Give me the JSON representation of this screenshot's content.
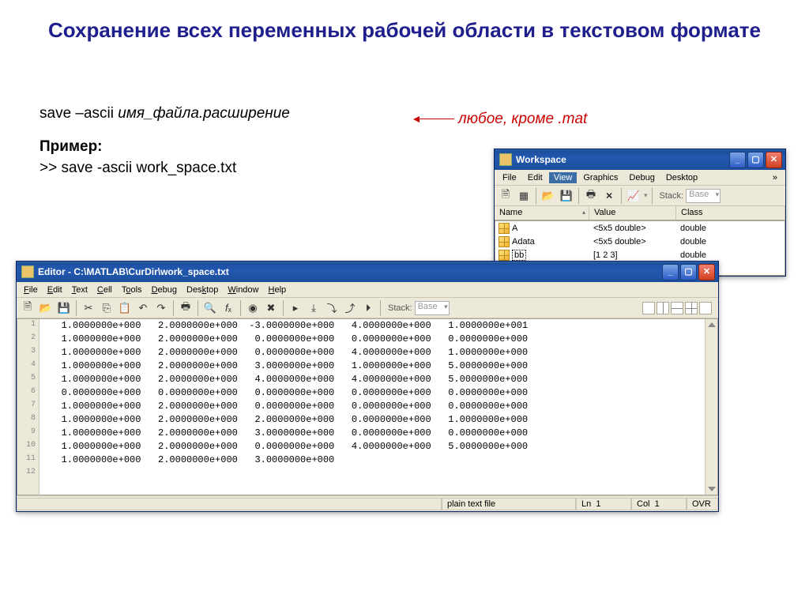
{
  "title": "Сохранение всех переменных рабочей области в текстовом формате",
  "syntax_prefix": "save –ascii ",
  "syntax_args": "имя_файла.расширение",
  "example_label": "Пример:",
  "example_cmd": ">> save -ascii work_space.txt",
  "annotation": "любое, кроме .mat",
  "workspace": {
    "title": "Workspace",
    "menus": [
      "File",
      "Edit",
      "View",
      "Graphics",
      "Debug",
      "Desktop"
    ],
    "stack_label": "Stack:",
    "stack_value": "Base",
    "columns": [
      "Name",
      "Value",
      "Class"
    ],
    "rows": [
      {
        "name": "A",
        "value": "<5x5 double>",
        "class": "double"
      },
      {
        "name": "Adata",
        "value": "<5x5 double>",
        "class": "double"
      },
      {
        "name": "bb",
        "value": "[1 2 3]",
        "class": "double"
      }
    ]
  },
  "editor": {
    "title": "Editor - C:\\MATLAB\\CurDir\\work_space.txt",
    "menus": [
      "File",
      "Edit",
      "Text",
      "Cell",
      "Tools",
      "Debug",
      "Desktop",
      "Window",
      "Help"
    ],
    "stack_label": "Stack:",
    "stack_value": "Base",
    "lines": [
      "   1.0000000e+000   2.0000000e+000  -3.0000000e+000   4.0000000e+000   1.0000000e+001",
      "   1.0000000e+000   2.0000000e+000   0.0000000e+000   0.0000000e+000   0.0000000e+000",
      "   1.0000000e+000   2.0000000e+000   0.0000000e+000   4.0000000e+000   1.0000000e+000",
      "   1.0000000e+000   2.0000000e+000   3.0000000e+000   1.0000000e+000   5.0000000e+000",
      "   1.0000000e+000   2.0000000e+000   4.0000000e+000   4.0000000e+000   5.0000000e+000",
      "   0.0000000e+000   0.0000000e+000   0.0000000e+000   0.0000000e+000   0.0000000e+000",
      "   1.0000000e+000   2.0000000e+000   0.0000000e+000   0.0000000e+000   0.0000000e+000",
      "   1.0000000e+000   2.0000000e+000   2.0000000e+000   0.0000000e+000   1.0000000e+000",
      "   1.0000000e+000   2.0000000e+000   3.0000000e+000   0.0000000e+000   0.0000000e+000",
      "   1.0000000e+000   2.0000000e+000   0.0000000e+000   4.0000000e+000   5.0000000e+000",
      "   1.0000000e+000   2.0000000e+000   3.0000000e+000",
      ""
    ],
    "status": {
      "filetype": "plain text file",
      "ln_label": "Ln",
      "ln": "1",
      "col_label": "Col",
      "col": "1",
      "ovr": "OVR"
    }
  }
}
